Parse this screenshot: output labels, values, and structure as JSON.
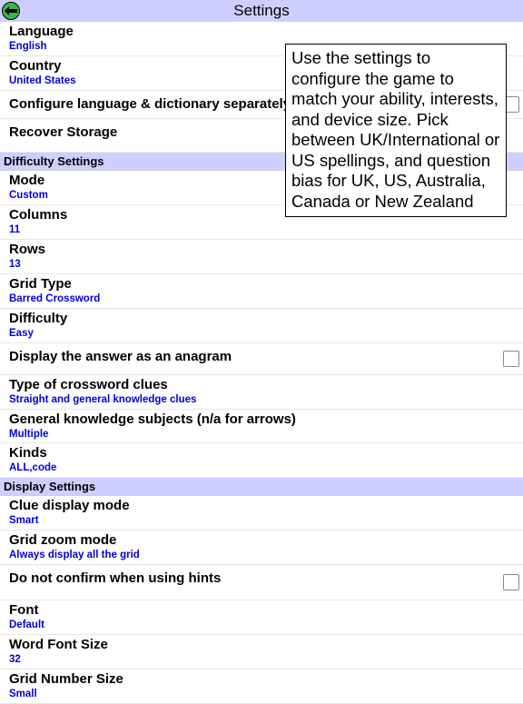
{
  "title": "Settings",
  "popover": "Use the settings to configure the game to match your ability, interests, and device size. Pick between UK/International or US spellings, and question bias for UK, US, Australia, Canada or New Zealand",
  "general": {
    "language": {
      "label": "Language",
      "value": "English"
    },
    "country": {
      "label": "Country",
      "value": "United States"
    },
    "configure": {
      "label": "Configure language & dictionary separately"
    },
    "recover": {
      "label": "Recover Storage"
    }
  },
  "sections": {
    "difficulty": "Difficulty Settings",
    "display": "Display Settings"
  },
  "difficulty": {
    "mode": {
      "label": "Mode",
      "value": "Custom"
    },
    "columns": {
      "label": "Columns",
      "value": "11"
    },
    "rows": {
      "label": "Rows",
      "value": "13"
    },
    "gridType": {
      "label": "Grid Type",
      "value": "Barred Crossword"
    },
    "difficulty": {
      "label": "Difficulty",
      "value": "Easy"
    },
    "anagram": {
      "label": "Display the answer as an anagram"
    },
    "clueType": {
      "label": "Type of crossword clues",
      "value": "Straight and general knowledge clues"
    },
    "subjects": {
      "label": "General knowledge subjects (n/a for arrows)",
      "value": "Multiple"
    },
    "kinds": {
      "label": "Kinds",
      "value": "ALL,code"
    }
  },
  "display": {
    "clueMode": {
      "label": "Clue display mode",
      "value": "Smart"
    },
    "zoom": {
      "label": "Grid zoom mode",
      "value": "Always display all the grid"
    },
    "noConfirm": {
      "label": "Do not confirm when using hints"
    },
    "font": {
      "label": "Font",
      "value": "Default"
    },
    "wordSize": {
      "label": "Word Font Size",
      "value": "32"
    },
    "gridNum": {
      "label": "Grid Number Size",
      "value": "Small"
    }
  }
}
